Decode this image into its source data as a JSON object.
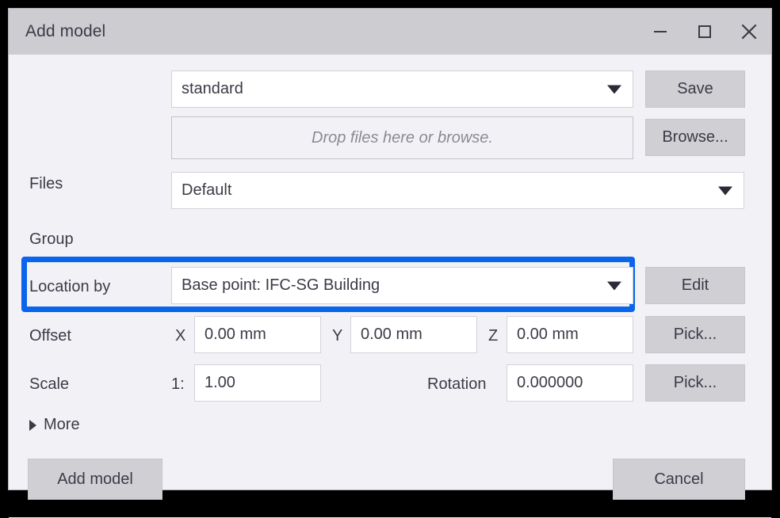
{
  "window": {
    "title": "Add model",
    "controls": [
      {
        "name": "minimize-button",
        "glyph": "minimize"
      },
      {
        "name": "maximize-button",
        "glyph": "maximize"
      },
      {
        "name": "close-button",
        "glyph": "close"
      }
    ]
  },
  "form": {
    "preset": {
      "value": "standard",
      "save_label": "Save"
    },
    "files": {
      "label": "Files",
      "dropzone_text": "Drop files here or browse.",
      "browse_label": "Browse..."
    },
    "group": {
      "label": "Group",
      "value": "Default"
    },
    "location_by": {
      "label": "Location by",
      "value": "Base point: IFC-SG Building",
      "edit_label": "Edit",
      "highlighted": true
    },
    "offset": {
      "label": "Offset",
      "x_label": "X",
      "x_value": "0.00 mm",
      "y_label": "Y",
      "y_value": "0.00 mm",
      "z_label": "Z",
      "z_value": "0.00 mm",
      "pick_label": "Pick..."
    },
    "scale": {
      "label": "Scale",
      "ratio_label": "1:",
      "value": "1.00",
      "rotation_label": "Rotation",
      "rotation_value": "0.000000",
      "pick_label": "Pick..."
    },
    "more": {
      "label": "More"
    }
  },
  "footer": {
    "primary_label": "Add model",
    "cancel_label": "Cancel"
  },
  "colors": {
    "highlight": "#0a64ec",
    "titlebar": "#ccccd1",
    "dialog_bg": "#f2f2f6",
    "button_bg": "#cfcfd4",
    "text": "#3b3b47"
  }
}
